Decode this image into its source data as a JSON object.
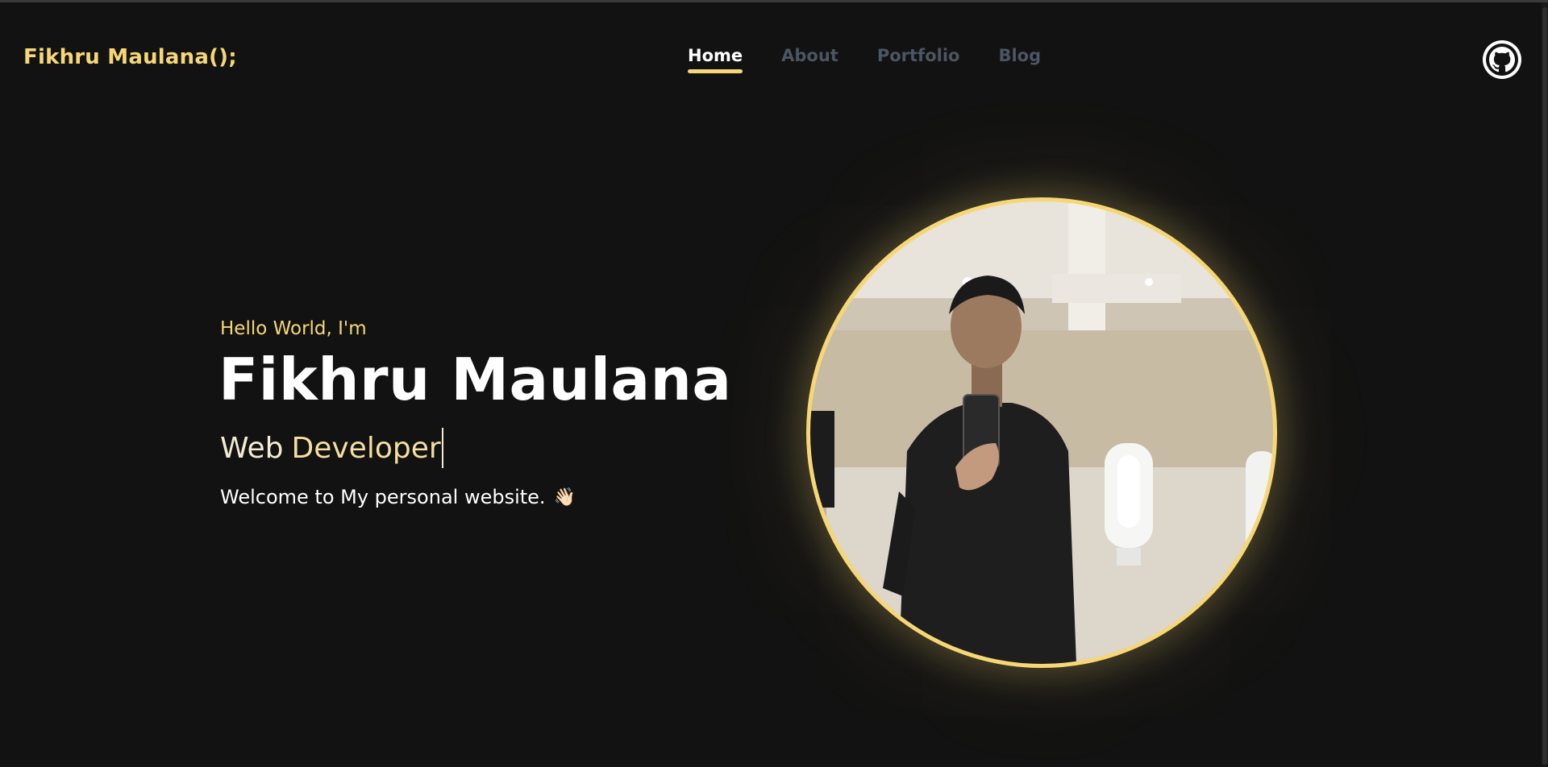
{
  "header": {
    "brand": "Fikhru Maulana();",
    "nav": [
      {
        "label": "Home",
        "active": true
      },
      {
        "label": "About",
        "active": false
      },
      {
        "label": "Portfolio",
        "active": false
      },
      {
        "label": "Blog",
        "active": false
      }
    ],
    "github_icon": "github-icon"
  },
  "hero": {
    "greeting": "Hello World, I'm",
    "name": "Fikhru Maulana",
    "role_part1": "Web",
    "role_part2": "Developer",
    "welcome": "Welcome to My personal website.",
    "wave_emoji": "👋🏻"
  },
  "photo": {
    "icon": "profile-photo"
  },
  "colors": {
    "accent": "#f7d774",
    "background": "#121212",
    "nav_inactive": "#4b5563",
    "text": "#ffffff"
  }
}
